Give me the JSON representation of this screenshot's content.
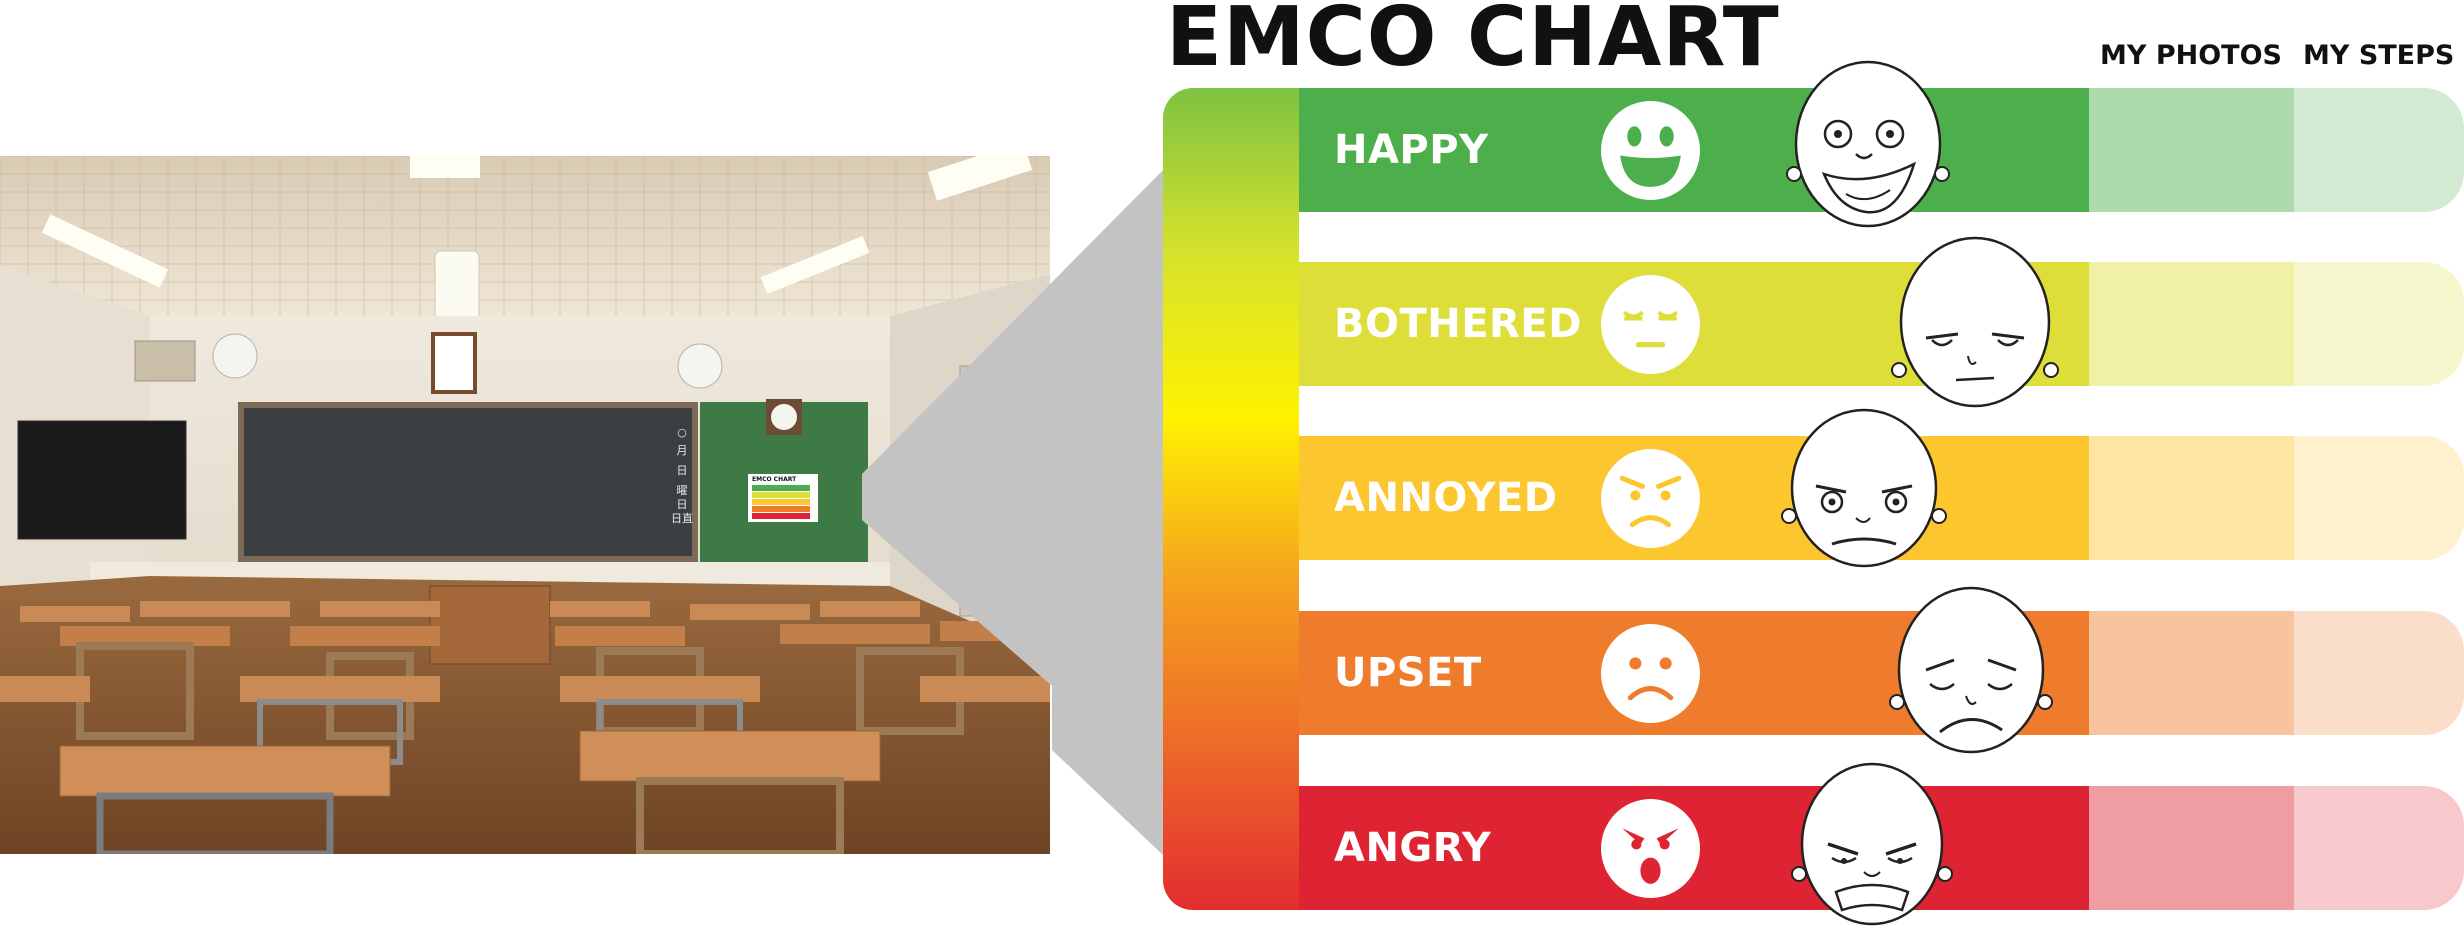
{
  "title": "EMCO CHART",
  "columns": {
    "photos": "MY PHOTOS",
    "steps": "MY STEPS"
  },
  "colors": {
    "happy": "#4caf4c",
    "bothered": "#dede3a",
    "annoyed": "#fcc62e",
    "upset": "#ef7c2c",
    "angry": "#de2432",
    "gradient": [
      "#7fc242",
      "#d6e22b",
      "#fff200",
      "#f6a11f",
      "#ed6a27",
      "#e22d2e"
    ],
    "connector": "#c3c3c3"
  },
  "emotions": [
    {
      "label": "HAPPY",
      "color": "#4caf4c",
      "emoji": "grin-face-icon",
      "cartoon": "happy-cartoon-face"
    },
    {
      "label": "BOTHERED",
      "color": "#dede3a",
      "emoji": "sleepy-face-icon",
      "cartoon": "bored-cartoon-face"
    },
    {
      "label": "ANNOYED",
      "color": "#fcc62e",
      "emoji": "annoyed-face-icon",
      "cartoon": "annoyed-cartoon-face"
    },
    {
      "label": "UPSET",
      "color": "#ef7c2c",
      "emoji": "sad-face-icon",
      "cartoon": "sad-cartoon-face"
    },
    {
      "label": "ANGRY",
      "color": "#de2432",
      "emoji": "angry-face-icon",
      "cartoon": "angry-cartoon-face"
    }
  ],
  "classroom": {
    "calendar_text": [
      "○",
      "月",
      "日",
      "曜",
      "日",
      "日直"
    ],
    "poster_title": "EMCO CHART"
  }
}
